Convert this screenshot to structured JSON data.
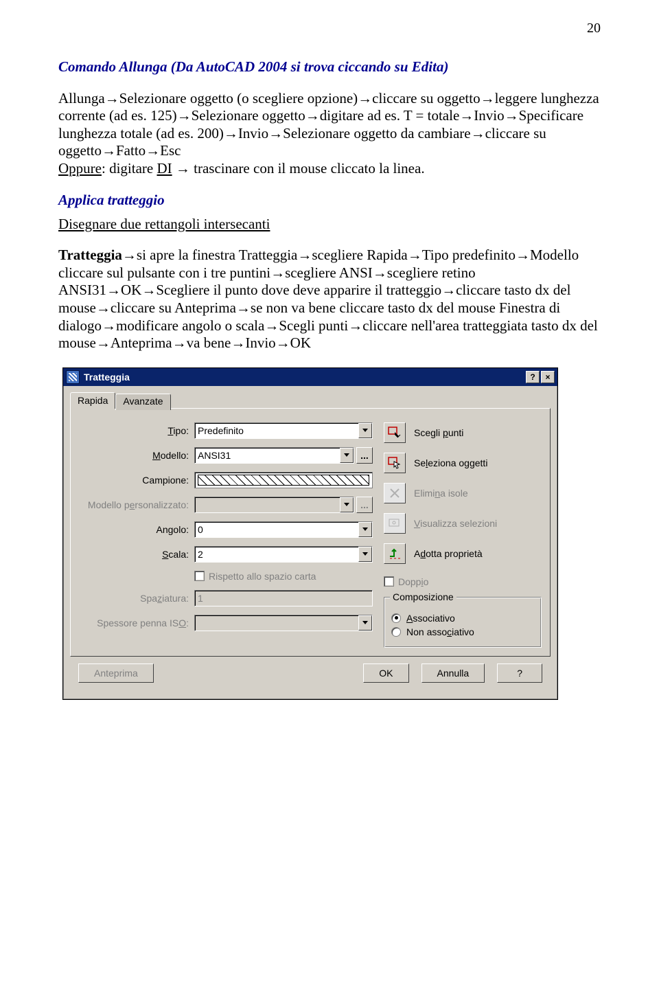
{
  "page_number": "20",
  "sections": {
    "allunga_title": "Comando Allunga (Da AutoCAD 2004 si trova ciccando su Edita)",
    "allunga_p1_parts": {
      "t1": "Allunga→Selezionare oggetto (o scegliere opzione)→cliccare su oggetto→leggere lunghezza corrente (ad es. 125)→Selezionare oggetto→digitare ad es. T = totale→Invio→Specificare lunghezza totale (ad es. 200)→Invio→Selezionare oggetto da cambiare→cliccare su oggetto→Fatto→Esc",
      "oppure": "Oppure",
      "t2": ": digitare ",
      "di": "DI",
      "t3": " → trascinare con il mouse cliccato la linea."
    },
    "tratteggio_title": "Applica tratteggio",
    "tratteggio_sub": "Disegnare due rettangoli intersecanti",
    "tratteggio_body": "Tratteggia→si apre la finestra Tratteggia→scegliere Rapida→Tipo predefinito→Modello cliccare sul pulsante con i tre puntini→scegliere ANSI→scegliere retino ANSI31→OK→Scegliere il punto dove deve apparire il tratteggio→cliccare tasto dx del mouse→cliccare su Anteprima→se non va bene cliccare tasto dx del mouse Finestra di dialogo→modificare angolo o scala→Scegli punti→cliccare nell'area tratteggiata tasto dx del mouse→Anteprima→va bene→Invio→OK"
  },
  "dialog": {
    "title": "Tratteggia",
    "help_btn": "?",
    "close_btn": "×",
    "tabs": {
      "rapida": "Rapida",
      "avanzate": "Avanzate"
    },
    "labels": {
      "tipo": "Tipo:",
      "modello": "Modello:",
      "campione": "Campione:",
      "personalizzato": "Modello personalizzato:",
      "angolo": "Angolo:",
      "scala": "Scala:",
      "rispetto": "Rispetto allo spazio carta",
      "spaziatura": "Spaziatura:",
      "spessore": "Spessore penna ISO:"
    },
    "values": {
      "tipo": "Predefinito",
      "modello": "ANSI31",
      "angolo": "0",
      "scala": "2",
      "spaziatura": "1",
      "spessore": ""
    },
    "right": {
      "scegli_punti": "Scegli punti",
      "seleziona_oggetti": "Seleziona oggetti",
      "elimina_isole": "Elimina isole",
      "visualizza_selezioni": "Visualizza selezioni",
      "adotta_proprieta": "Adotta proprietà",
      "doppio": "Doppio",
      "composizione": "Composizione",
      "associativo": "Associativo",
      "non_associativo": "Non associativo"
    },
    "buttons": {
      "anteprima": "Anteprima",
      "ok": "OK",
      "annulla": "Annulla",
      "help": "?"
    }
  }
}
